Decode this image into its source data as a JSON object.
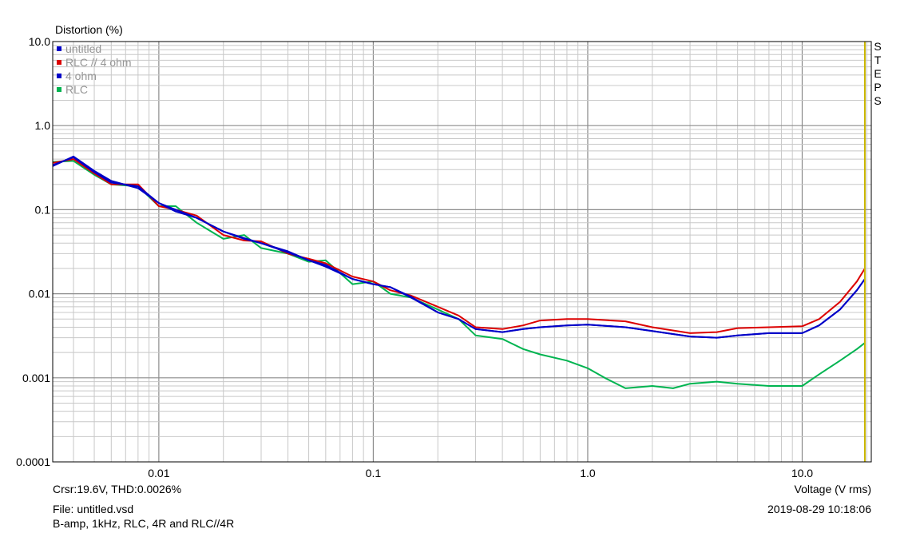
{
  "chart_data": {
    "type": "line",
    "title": "",
    "ylabel": "Distortion (%)",
    "xlabel": "Voltage (V rms)",
    "x_scale": "log",
    "y_scale": "log",
    "xlim": [
      0.0032,
      21
    ],
    "ylim": [
      0.0001,
      10
    ],
    "grid": true,
    "x_tick_labels": [
      "0.01",
      "0.1",
      "1.0",
      "10.0"
    ],
    "y_tick_labels": [
      "10.0",
      "1.0",
      "0.1",
      "0.01",
      "0.001",
      "0.0001"
    ],
    "side_label": "STEPS",
    "cursor_x": 19.6,
    "cursor_color": "#c8b400",
    "legend_position": "top-left",
    "series": [
      {
        "name": "untitled",
        "color": "#0000c8",
        "x": [
          0.0032,
          0.004,
          0.005,
          0.006,
          0.008,
          0.01,
          0.012,
          0.015,
          0.02,
          0.025,
          0.03,
          0.04,
          0.05,
          0.06,
          0.08,
          0.1,
          0.12,
          0.15,
          0.2,
          0.25,
          0.3,
          0.4,
          0.5,
          0.6,
          0.8,
          1.0,
          1.5,
          2.0,
          3.0,
          4.0,
          5.0,
          7.0,
          10.0,
          12.0,
          15.0,
          18.0,
          19.6
        ],
        "y": [
          0.34,
          0.42,
          0.28,
          0.21,
          0.19,
          0.12,
          0.1,
          0.08,
          0.055,
          0.045,
          0.04,
          0.032,
          0.025,
          0.022,
          0.015,
          0.013,
          0.012,
          0.009,
          0.006,
          0.005,
          0.0038,
          0.0035,
          0.0038,
          0.004,
          0.0042,
          0.0043,
          0.004,
          0.0036,
          0.0031,
          0.003,
          0.0032,
          0.0034,
          0.0034,
          0.0042,
          0.0065,
          0.011,
          0.015
        ]
      },
      {
        "name": "RLC // 4 ohm",
        "color": "#dc0000",
        "x": [
          0.0032,
          0.004,
          0.005,
          0.006,
          0.008,
          0.01,
          0.012,
          0.015,
          0.02,
          0.025,
          0.03,
          0.04,
          0.05,
          0.06,
          0.08,
          0.1,
          0.12,
          0.15,
          0.2,
          0.25,
          0.3,
          0.4,
          0.5,
          0.6,
          0.8,
          1.0,
          1.5,
          2.0,
          3.0,
          4.0,
          5.0,
          7.0,
          10.0,
          12.0,
          15.0,
          18.0,
          19.6
        ],
        "y": [
          0.36,
          0.4,
          0.27,
          0.2,
          0.2,
          0.11,
          0.1,
          0.085,
          0.05,
          0.043,
          0.042,
          0.03,
          0.026,
          0.023,
          0.016,
          0.014,
          0.011,
          0.0095,
          0.007,
          0.0055,
          0.004,
          0.0038,
          0.0042,
          0.0048,
          0.005,
          0.005,
          0.0047,
          0.004,
          0.0034,
          0.0035,
          0.0039,
          0.004,
          0.0041,
          0.005,
          0.008,
          0.014,
          0.02
        ]
      },
      {
        "name": "4 ohm",
        "color": "#0000c8",
        "x": [
          0.0032,
          0.004,
          0.005,
          0.006,
          0.008,
          0.01,
          0.012,
          0.015,
          0.02,
          0.025,
          0.03,
          0.04,
          0.05,
          0.06,
          0.08,
          0.1,
          0.12,
          0.15,
          0.2,
          0.25,
          0.3,
          0.4,
          0.5,
          0.6,
          0.8,
          1.0,
          1.5,
          2.0,
          3.0,
          4.0,
          5.0,
          7.0,
          10.0,
          12.0,
          15.0,
          18.0,
          19.6
        ],
        "y": [
          0.33,
          0.43,
          0.29,
          0.22,
          0.18,
          0.12,
          0.095,
          0.08,
          0.055,
          0.046,
          0.04,
          0.031,
          0.025,
          0.021,
          0.015,
          0.013,
          0.012,
          0.0092,
          0.006,
          0.005,
          0.0038,
          0.0035,
          0.0038,
          0.004,
          0.0042,
          0.0043,
          0.004,
          0.0036,
          0.0031,
          0.003,
          0.0032,
          0.0034,
          0.0034,
          0.0042,
          0.0065,
          0.011,
          0.015
        ]
      },
      {
        "name": "RLC",
        "color": "#00b450",
        "x": [
          0.0032,
          0.004,
          0.005,
          0.006,
          0.008,
          0.01,
          0.012,
          0.015,
          0.02,
          0.025,
          0.03,
          0.04,
          0.05,
          0.06,
          0.08,
          0.1,
          0.12,
          0.15,
          0.2,
          0.25,
          0.3,
          0.4,
          0.5,
          0.6,
          0.8,
          1.0,
          1.2,
          1.5,
          2.0,
          2.5,
          3.0,
          4.0,
          5.0,
          7.0,
          10.0,
          12.0,
          15.0,
          18.0,
          19.6
        ],
        "y": [
          0.37,
          0.38,
          0.26,
          0.2,
          0.19,
          0.11,
          0.11,
          0.07,
          0.045,
          0.05,
          0.035,
          0.03,
          0.024,
          0.025,
          0.013,
          0.014,
          0.01,
          0.009,
          0.0065,
          0.005,
          0.0032,
          0.0029,
          0.0022,
          0.0019,
          0.0016,
          0.0013,
          0.001,
          0.00075,
          0.0008,
          0.00075,
          0.00085,
          0.0009,
          0.00085,
          0.0008,
          0.0008,
          0.0011,
          0.0016,
          0.0022,
          0.0026
        ]
      }
    ]
  },
  "footer": {
    "cursor_readout": "Crsr:19.6V, THD:0.0026%",
    "file": "File: untitled.vsd",
    "description": "B-amp, 1kHz, RLC, 4R and RLC//4R",
    "datetime": "2019-08-29  10:18:06"
  }
}
